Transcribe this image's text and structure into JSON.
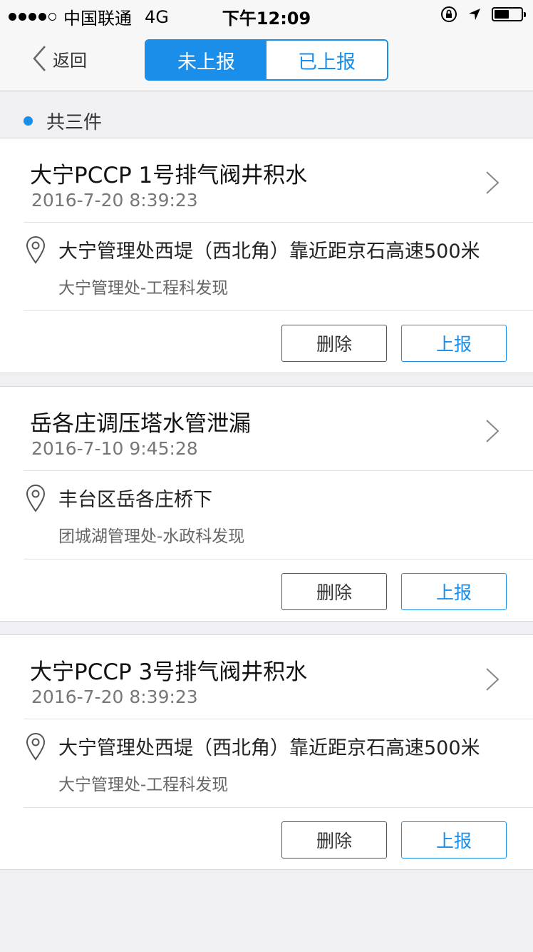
{
  "status_bar": {
    "carrier": "中国联通",
    "network": "4G",
    "time": "下午12:09",
    "signal_bars_filled": 4,
    "signal_bars_total": 5,
    "battery_level": 0.5
  },
  "nav": {
    "back_label": "返回",
    "tabs": [
      {
        "label": "未上报",
        "active": true
      },
      {
        "label": "已上报",
        "active": false
      }
    ]
  },
  "summary": {
    "count_text": "共三件"
  },
  "reports": [
    {
      "title": "大宁PCCP 1号排气阀井积水",
      "datetime": "2016-7-20   8:39:23",
      "location": "大宁管理处西堤（西北角）靠近距京石高速500米",
      "department": "大宁管理处-工程科发现",
      "delete_label": "删除",
      "report_label": "上报"
    },
    {
      "title": "岳各庄调压塔水管泄漏",
      "datetime": "2016-7-10   9:45:28",
      "location": "丰台区岳各庄桥下",
      "department": "团城湖管理处-水政科发现",
      "delete_label": "删除",
      "report_label": "上报"
    },
    {
      "title": "大宁PCCP 3号排气阀井积水",
      "datetime": "2016-7-20   8:39:23",
      "location": "大宁管理处西堤（西北角）靠近距京石高速500米",
      "department": "大宁管理处-工程科发现",
      "delete_label": "删除",
      "report_label": "上报"
    }
  ],
  "icons": {
    "back": "chevron-left-icon",
    "detail": "chevron-right-icon",
    "location": "location-pin-icon",
    "orientation_lock": "orientation-lock-icon",
    "gps": "location-arrow-icon",
    "battery": "battery-icon"
  },
  "colors": {
    "accent": "#1a8ee8",
    "background": "#efeff4",
    "card": "#ffffff"
  }
}
